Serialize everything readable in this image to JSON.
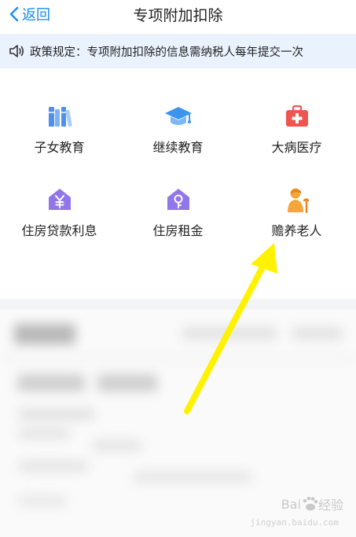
{
  "nav": {
    "back_label": "返回",
    "title": "专项附加扣除"
  },
  "notice": {
    "text": "政策规定：专项附加扣除的信息需纳税人每年提交一次"
  },
  "items": [
    {
      "label": "子女教育",
      "icon": "books-icon",
      "color": "#5b9cf1"
    },
    {
      "label": "继续教育",
      "icon": "graduation-cap-icon",
      "color": "#3d94ef"
    },
    {
      "label": "大病医疗",
      "icon": "medical-kit-icon",
      "color": "#f0544f"
    },
    {
      "label": "住房贷款利息",
      "icon": "house-yuan-icon",
      "color": "#9176e9"
    },
    {
      "label": "住房租金",
      "icon": "house-key-icon",
      "color": "#9176e9"
    },
    {
      "label": "赡养老人",
      "icon": "elderly-person-icon",
      "color": "#f4a53b"
    }
  ],
  "colors": {
    "accent": "#1a8cf0",
    "notice_bg": "#eaf3fd",
    "arrow": "#fff200"
  },
  "watermark": {
    "brand": "Bai",
    "brand2": "经验",
    "url": "jingyan.baidu.com"
  }
}
